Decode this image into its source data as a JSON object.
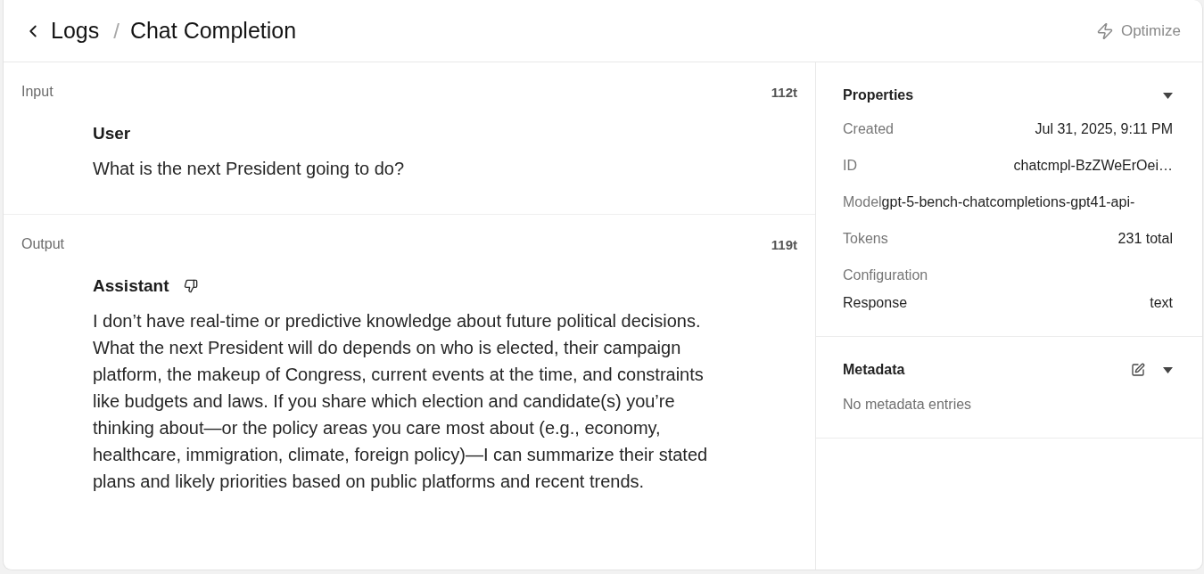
{
  "header": {
    "breadcrumb": [
      {
        "label": "Logs"
      },
      {
        "label": "Chat Completion"
      }
    ],
    "separator": "/",
    "action": {
      "label": "Optimize"
    }
  },
  "sections": [
    {
      "label": "Input",
      "tokens": "112t",
      "messages": [
        {
          "role": "User",
          "feedback_button": false,
          "text": "What is the next President going to do?"
        }
      ]
    },
    {
      "label": "Output",
      "tokens": "119t",
      "messages": [
        {
          "role": "Assistant",
          "feedback_button": true,
          "text": "I don’t have real-time or predictive knowledge about future political decisions. What the next President will do depends on who is elected, their campaign platform, the makeup of Congress, current events at the time, and constraints like budgets and laws. If you share which election and candidate(s) you’re thinking about—or the policy areas you care most about (e.g., economy, healthcare, immigration, climate, foreign policy)—I can summarize their stated plans and likely priorities based on public platforms and recent trends."
        }
      ]
    }
  ],
  "properties": {
    "title": "Properties",
    "expanded": true,
    "rows": [
      {
        "kind": "pair",
        "label": "Created",
        "value": "Jul 31, 2025, 9:11 PM"
      },
      {
        "kind": "pair",
        "label": "ID",
        "value": "chatcmpl-BzZWeErOei…"
      },
      {
        "kind": "inline",
        "label": "Model",
        "value": "gpt-5-bench-chatcompletions-gpt41-api-"
      },
      {
        "kind": "pair",
        "label": "Tokens",
        "value": "231 total"
      }
    ],
    "configuration": {
      "title": "Configuration",
      "rows": [
        {
          "label": "Response",
          "value": "text"
        }
      ]
    }
  },
  "metadata": {
    "title": "Metadata",
    "expanded": true,
    "empty_text": "No metadata entries"
  }
}
